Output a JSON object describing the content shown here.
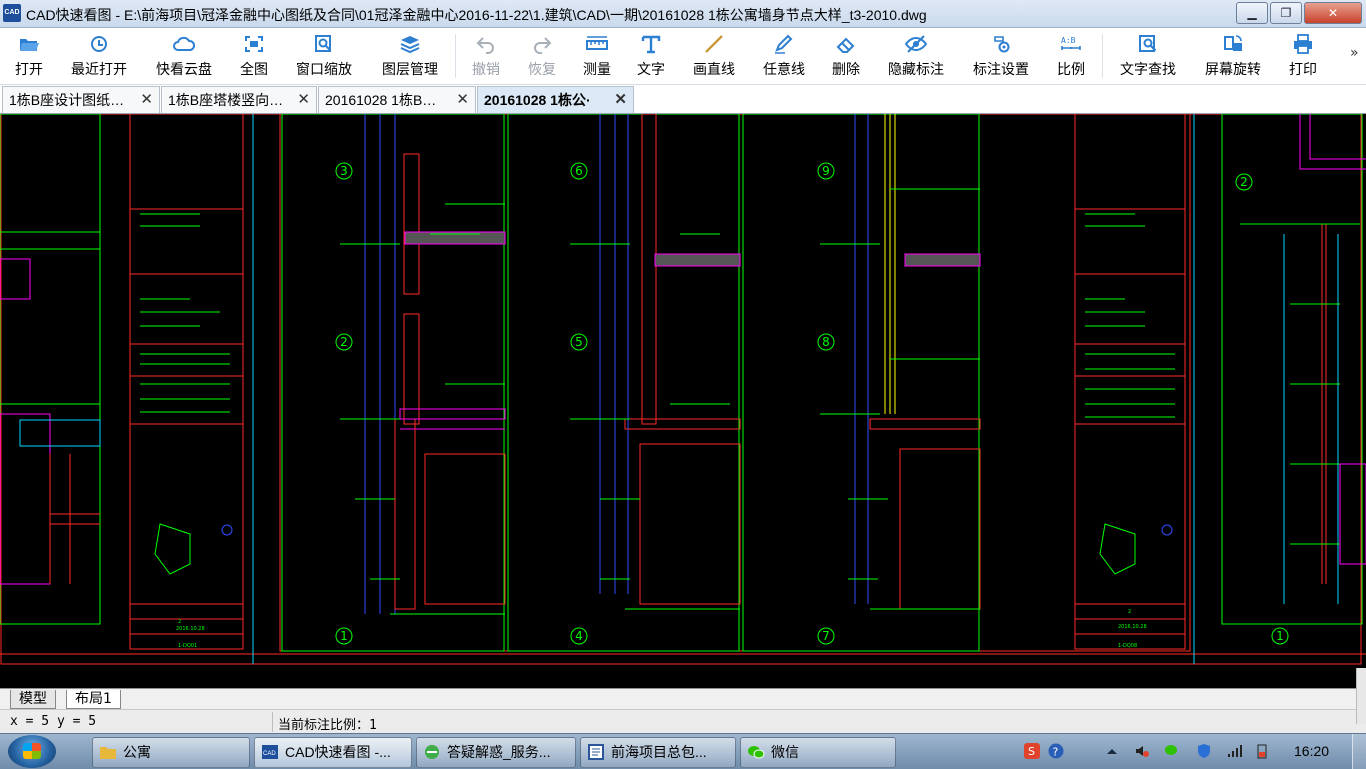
{
  "window": {
    "logo_text": "CAD",
    "title": "CAD快速看图 - E:\\前海项目\\冠泽金融中心图纸及合同\\01冠泽金融中心2016-11-22\\1.建筑\\CAD\\一期\\20161028 1栋公寓墙身节点大样_t3-2010.dwg",
    "minimize": "▁",
    "maximize": "❐",
    "close": "✕"
  },
  "toolbar": {
    "items": [
      {
        "label": "打开",
        "icon": "folder-open-icon"
      },
      {
        "label": "最近打开",
        "icon": "recent-clock-icon"
      },
      {
        "label": "快看云盘",
        "icon": "cloud-icon"
      },
      {
        "label": "全图",
        "icon": "fit-all-icon"
      },
      {
        "label": "窗口缩放",
        "icon": "window-zoom-icon"
      },
      {
        "label": "图层管理",
        "icon": "layers-icon"
      },
      {
        "label": "撤销",
        "icon": "undo-icon",
        "disabled": true
      },
      {
        "label": "恢复",
        "icon": "redo-icon",
        "disabled": true
      },
      {
        "label": "测量",
        "icon": "ruler-icon"
      },
      {
        "label": "文字",
        "icon": "text-icon"
      },
      {
        "label": "画直线",
        "icon": "line-icon"
      },
      {
        "label": "任意线",
        "icon": "pen-icon"
      },
      {
        "label": "删除",
        "icon": "eraser-icon"
      },
      {
        "label": "隐藏标注",
        "icon": "eye-hide-icon"
      },
      {
        "label": "标注设置",
        "icon": "settings-icon"
      },
      {
        "label": "比例",
        "icon": "scale-ab-icon"
      },
      {
        "label": "文字查找",
        "icon": "text-search-icon"
      },
      {
        "label": "屏幕旋转",
        "icon": "rotate-screen-icon"
      },
      {
        "label": "打印",
        "icon": "printer-icon"
      }
    ],
    "more": "»"
  },
  "tabs": [
    {
      "label": "1栋B座设计图纸…",
      "close": "✕"
    },
    {
      "label": "1栋B座塔楼竖向…",
      "close": "✕"
    },
    {
      "label": "20161028 1栋B…",
      "close": "✕"
    },
    {
      "label": "20161028 1栋公·",
      "close": "✕",
      "active": true
    }
  ],
  "drawing": {
    "markers": [
      "3",
      "2",
      "1",
      "6",
      "5",
      "4",
      "9",
      "8",
      "7",
      "2",
      "1"
    ],
    "dates": [
      "2016.10.28",
      "2016.10.28"
    ],
    "drawing_nos": [
      "1-DQ01",
      "1-DQ08"
    ],
    "sheet_nos": [
      "2",
      "2"
    ]
  },
  "layout_tabs": {
    "model": "模型",
    "layout": "布局1"
  },
  "status": {
    "coords": "x = 5 y = 5",
    "scale": "当前标注比例：1"
  },
  "taskbar": {
    "items": [
      {
        "label": "公寓",
        "icon": "folder-icon"
      },
      {
        "label": "CAD快速看图 -...",
        "icon": "cad-app-icon",
        "active": true
      },
      {
        "label": "答疑解惑_服务...",
        "icon": "browser-icon"
      },
      {
        "label": "前海项目总包...",
        "icon": "document-icon"
      },
      {
        "label": "微信",
        "icon": "wechat-icon"
      }
    ],
    "clock": "16:20"
  },
  "colors": {
    "cad_background": "#000000",
    "cad_green": "#00ff00",
    "cad_red": "#ff2a2a",
    "cad_cyan": "#00d8ff",
    "cad_magenta": "#ff00ff",
    "cad_blue": "#2f4cff",
    "cad_yellow": "#ffff00"
  }
}
